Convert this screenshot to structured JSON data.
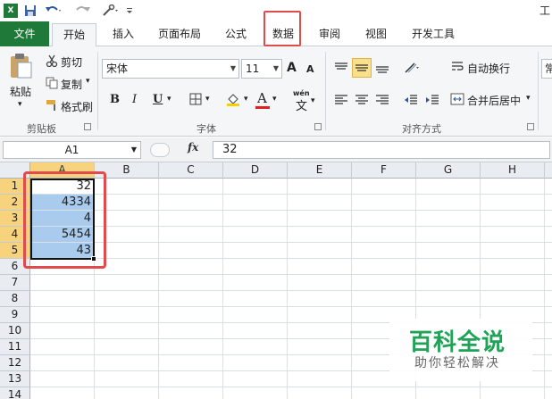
{
  "window": {
    "title_partial": "工"
  },
  "qat": {
    "save_icon": "save-icon",
    "undo_icon": "undo-icon",
    "redo_icon": "redo-icon",
    "tools_icon": "tools-icon",
    "customize_icon": "customize-icon"
  },
  "tabs": [
    {
      "label": "文件"
    },
    {
      "label": "开始"
    },
    {
      "label": "插入"
    },
    {
      "label": "页面布局"
    },
    {
      "label": "公式"
    },
    {
      "label": "数据"
    },
    {
      "label": "审阅"
    },
    {
      "label": "视图"
    },
    {
      "label": "开发工具"
    }
  ],
  "ribbon": {
    "clipboard": {
      "paste": "粘贴",
      "cut": "剪切",
      "copy": "复制",
      "format_painter": "格式刷",
      "group": "剪贴板"
    },
    "font": {
      "name": "宋体",
      "size": "11",
      "bold": "B",
      "italic": "I",
      "underline": "U",
      "grow": "A",
      "shrink": "A",
      "color_letter": "A",
      "phonetic": "wén",
      "phonetic_char": "文",
      "group": "字体"
    },
    "alignment": {
      "wrap": "自动换行",
      "merge": "合并后居中",
      "group": "对齐方式"
    },
    "number": {
      "partial": "常"
    }
  },
  "formula_bar": {
    "name_box": "A1",
    "fx": "fx",
    "value": "32"
  },
  "sheet": {
    "columns": [
      "A",
      "B",
      "C",
      "D",
      "E",
      "F",
      "G",
      "H"
    ],
    "rows": [
      "1",
      "2",
      "3",
      "4",
      "5",
      "6",
      "7",
      "8",
      "9",
      "10",
      "11",
      "12",
      "13",
      "14"
    ],
    "cells": {
      "A1": "32",
      "A2": "4334",
      "A3": "4",
      "A4": "5454",
      "A5": "43"
    }
  },
  "watermark": {
    "title": "百科全说",
    "subtitle": "助你轻松解决"
  },
  "colors": {
    "file_tab": "#1f7a3a",
    "highlight": "#e14b4b",
    "selection": "#a9ccee",
    "header_selected": "#f7d37d",
    "watermark": "#1fa356"
  }
}
